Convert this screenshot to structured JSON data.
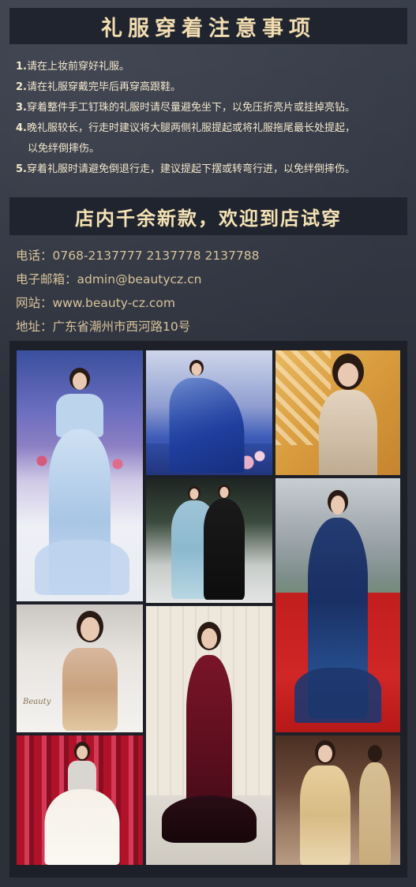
{
  "notice": {
    "title": "礼服穿着注意事项",
    "items": [
      {
        "num": "1.",
        "text": "请在上妆前穿好礼服。"
      },
      {
        "num": "2.",
        "text": "请在礼服穿戴完毕后再穿高跟鞋。"
      },
      {
        "num": "3.",
        "text": "穿着整件手工钉珠的礼服时请尽量避免坐下，以免压折亮片或挂掉亮钻。"
      },
      {
        "num": "4.",
        "text": "晚礼服较长，行走时建议将大腿两侧礼服提起或将礼服拖尾最长处提起，",
        "text2": "以免绊倒摔伤。"
      },
      {
        "num": "5.",
        "text": "穿着礼服时请避免倒退行走，建议提起下摆或转弯行进，以免绊倒摔伤。"
      }
    ]
  },
  "promo": {
    "title": "店内千余新款，欢迎到店试穿"
  },
  "contact": {
    "phone": "电话：0768-2137777  2137778  2137788",
    "email": "电子邮箱：admin@beautycz.cn",
    "website": "网站：www.beauty-cz.com",
    "address": "地址：广东省潮州市西河路10号"
  },
  "gallery": {
    "watermark": "Beauty",
    "photos": [
      {
        "name": "light-blue-mermaid-gown-runway"
      },
      {
        "name": "blue-gown-with-cape"
      },
      {
        "name": "champagne-sequin-gown"
      },
      {
        "name": "two-models-blue-and-black-gowns"
      },
      {
        "name": "navy-sequin-gown-red-carpet"
      },
      {
        "name": "gold-embellished-gown-seated"
      },
      {
        "name": "burgundy-sequin-mermaid-gown"
      },
      {
        "name": "white-gown-dress-rack"
      },
      {
        "name": "gold-gown-indoor"
      }
    ]
  },
  "colors": {
    "banner_bg": "#20242e",
    "banner_text": "#f2ddb0",
    "notice_text": "#f3e7cc",
    "contact_text": "#d8c39a",
    "page_bg": "#2f3440"
  }
}
